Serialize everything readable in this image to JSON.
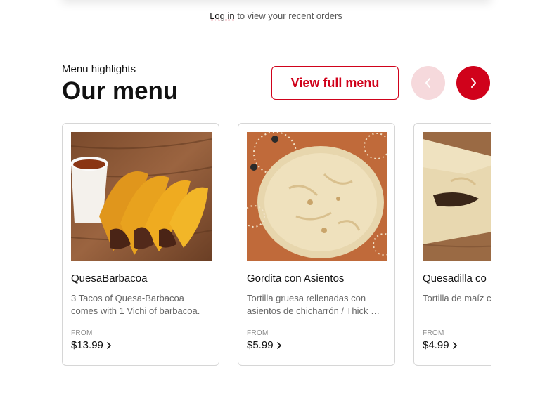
{
  "login": {
    "link_label": "Log in",
    "suffix": " to view your recent orders"
  },
  "menu": {
    "eyebrow": "Menu highlights",
    "title": "Our menu",
    "view_full_menu_label": "View full menu",
    "accent_color": "#d0021b",
    "items": [
      {
        "name": "QuesaBarbacoa",
        "description": "3 Tacos of Quesa-Barbacoa comes with 1 Vichi of barbacoa.",
        "from_label": "FROM",
        "price": "$13.99",
        "image_icon": "tacos-photo"
      },
      {
        "name": "Gordita con Asientos",
        "description": "Tortilla gruesa rellenadas con asientos de chicharrón / Thick …",
        "from_label": "FROM",
        "price": "$5.99",
        "image_icon": "gordita-photo"
      },
      {
        "name": "Quesadilla co",
        "description": "Tortilla de maíz c de queso fundid",
        "from_label": "FROM",
        "price": "$4.99",
        "image_icon": "quesadilla-photo"
      }
    ]
  }
}
